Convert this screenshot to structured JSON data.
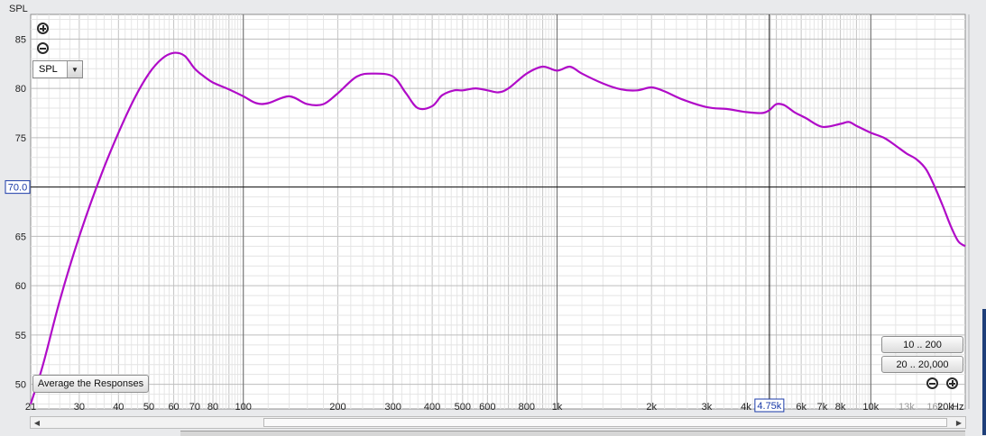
{
  "chart_data": {
    "type": "line",
    "ylabel": "SPL",
    "xunit": "kHz",
    "xscale": "log",
    "xlim": [
      21,
      20000
    ],
    "ylim": [
      47.5,
      87.5
    ],
    "yticks": [
      50,
      55,
      60,
      65,
      70,
      75,
      80,
      85
    ],
    "xticks": [
      {
        "value": 21,
        "label": "21"
      },
      {
        "value": 30,
        "label": "30"
      },
      {
        "value": 40,
        "label": "40"
      },
      {
        "value": 50,
        "label": "50"
      },
      {
        "value": 60,
        "label": "60"
      },
      {
        "value": 70,
        "label": "70"
      },
      {
        "value": 80,
        "label": "80"
      },
      {
        "value": 100,
        "label": "100"
      },
      {
        "value": 200,
        "label": "200"
      },
      {
        "value": 300,
        "label": "300"
      },
      {
        "value": 400,
        "label": "400"
      },
      {
        "value": 500,
        "label": "500"
      },
      {
        "value": 600,
        "label": "600"
      },
      {
        "value": 800,
        "label": "800"
      },
      {
        "value": 1000,
        "label": "1k"
      },
      {
        "value": 2000,
        "label": "2k"
      },
      {
        "value": 3000,
        "label": "3k"
      },
      {
        "value": 4000,
        "label": "4k"
      },
      {
        "value": 6000,
        "label": "6k"
      },
      {
        "value": 7000,
        "label": "7k"
      },
      {
        "value": 8000,
        "label": "8k"
      },
      {
        "value": 10000,
        "label": "10k"
      },
      {
        "value": 13000,
        "label": "13k",
        "muted": true
      },
      {
        "value": 16000,
        "label": "16k",
        "muted": true
      },
      {
        "value": 20000,
        "label": "20k"
      }
    ],
    "cursor": {
      "x": 4750,
      "x_label": "4.75k",
      "y": 70.0,
      "y_label": "70.0"
    },
    "grid": true,
    "series": [
      {
        "color": "#b00bc8",
        "x": [
          21,
          23,
          26,
          30,
          35,
          40,
          45,
          50,
          55,
          60,
          65,
          70,
          75,
          80,
          90,
          100,
          110,
          120,
          140,
          160,
          180,
          200,
          230,
          260,
          300,
          330,
          360,
          400,
          430,
          470,
          500,
          550,
          600,
          650,
          700,
          800,
          900,
          1000,
          1100,
          1200,
          1400,
          1600,
          1800,
          2000,
          2200,
          2500,
          3000,
          3500,
          4000,
          4500,
          4750,
          5000,
          5300,
          5700,
          6200,
          7000,
          8000,
          8500,
          9000,
          10000,
          11000,
          12000,
          13000,
          14000,
          15000,
          16000,
          17000,
          18000,
          19000,
          20000
        ],
        "y": [
          48.0,
          52.0,
          58.5,
          65.0,
          71.0,
          75.5,
          79.0,
          81.5,
          83.0,
          83.6,
          83.3,
          82.0,
          81.2,
          80.6,
          79.9,
          79.2,
          78.5,
          78.5,
          79.2,
          78.4,
          78.4,
          79.5,
          81.2,
          81.5,
          81.2,
          79.5,
          78.0,
          78.2,
          79.3,
          79.8,
          79.8,
          80.0,
          79.8,
          79.6,
          80.0,
          81.5,
          82.2,
          81.8,
          82.2,
          81.5,
          80.5,
          79.9,
          79.8,
          80.1,
          79.7,
          78.9,
          78.1,
          77.9,
          77.6,
          77.5,
          77.8,
          78.4,
          78.3,
          77.6,
          77.0,
          76.1,
          76.4,
          76.6,
          76.2,
          75.5,
          75.0,
          74.2,
          73.4,
          72.8,
          71.8,
          70.0,
          68.0,
          66.0,
          64.5,
          64.0
        ]
      }
    ]
  },
  "buttons": {
    "range_low": "10 .. 200",
    "range_high": "20 .. 20,000",
    "average": "Average the Responses"
  },
  "dropdown": {
    "selected": "SPL"
  },
  "icons": {
    "zoom_in_top": "plus-circle-icon",
    "zoom_out_top": "minus-circle-icon",
    "zoom_out_bottom": "minus-circle-icon",
    "zoom_in_bottom": "plus-circle-icon",
    "scroll_left": "triangle-left-icon",
    "scroll_right": "triangle-right-icon",
    "dropdown_arrow": "triangle-down-icon"
  }
}
